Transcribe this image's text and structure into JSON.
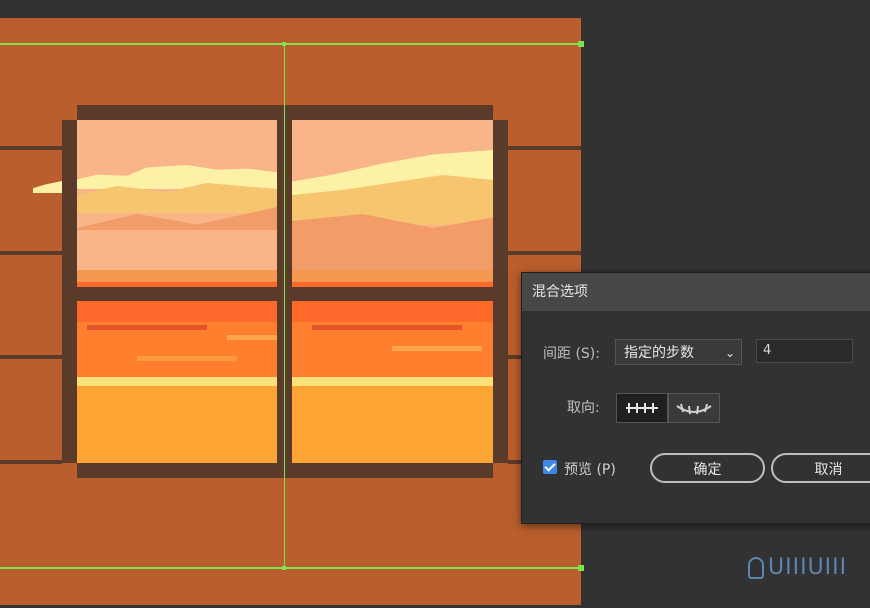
{
  "dialog": {
    "title": "混合选项",
    "spacing_label": "间距 (S):",
    "spacing_value": "指定的步数",
    "steps_value": "4",
    "orientation_label": "取向:",
    "preview_label": "预览 (P)",
    "preview_checked": true,
    "ok_label": "确定",
    "cancel_label": "取消",
    "orientation_options": [
      "align-to-page-icon",
      "align-to-path-icon"
    ]
  },
  "watermark": {
    "text": "UIIIUIII"
  },
  "colors": {
    "artboard": "#b95e2c",
    "guides": "#7ee34f",
    "frame": "#5a3a28",
    "accent": "#3f86e8"
  }
}
